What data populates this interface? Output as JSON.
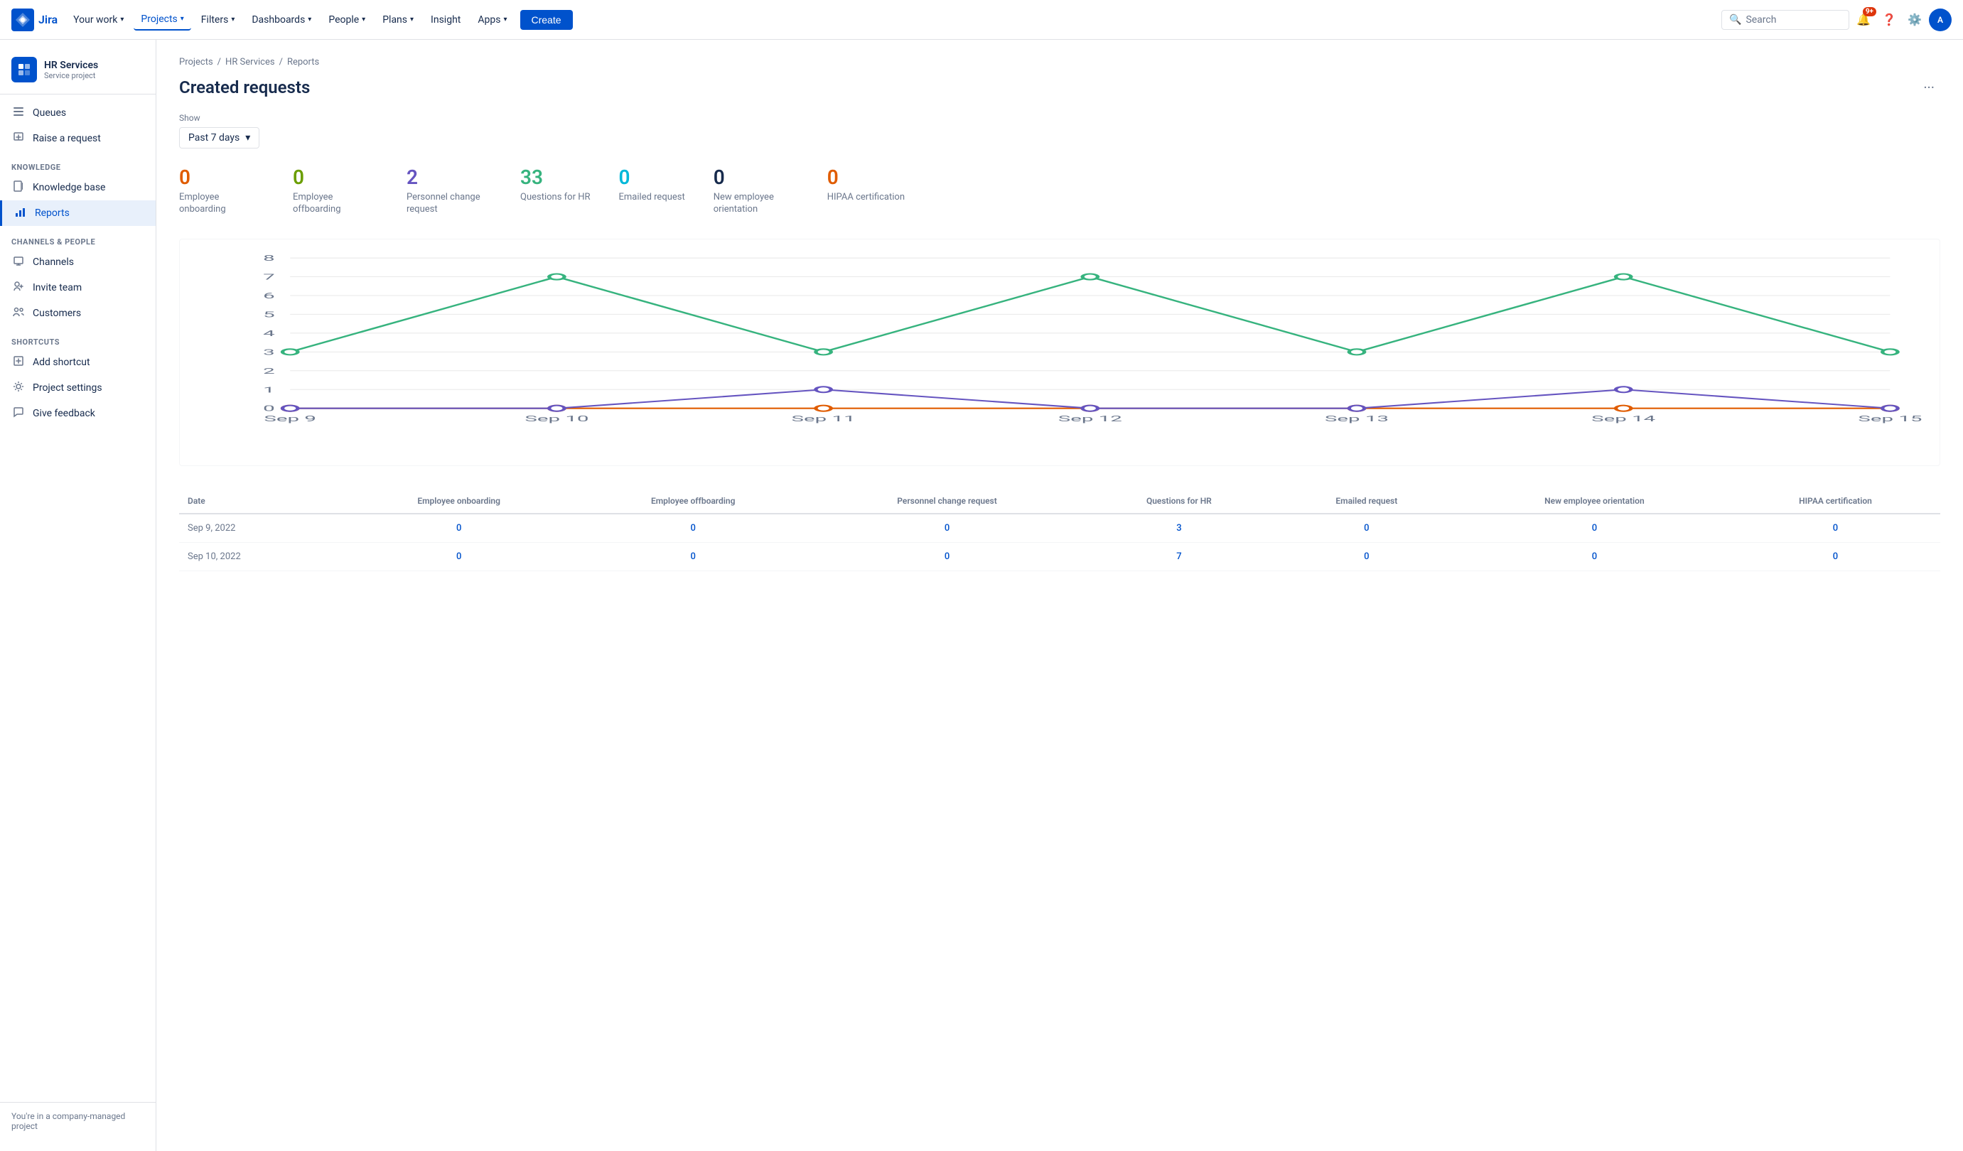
{
  "topnav": {
    "logo_text": "Jira",
    "items": [
      {
        "label": "Your work",
        "has_dropdown": true
      },
      {
        "label": "Projects",
        "has_dropdown": true,
        "active": true
      },
      {
        "label": "Filters",
        "has_dropdown": true
      },
      {
        "label": "Dashboards",
        "has_dropdown": true
      },
      {
        "label": "People",
        "has_dropdown": true
      },
      {
        "label": "Plans",
        "has_dropdown": true
      },
      {
        "label": "Insight",
        "has_dropdown": false
      },
      {
        "label": "Apps",
        "has_dropdown": true
      }
    ],
    "create_label": "Create",
    "search_placeholder": "Search",
    "notification_count": "9+"
  },
  "sidebar": {
    "project_name": "HR Services",
    "project_type": "Service project",
    "nav_items": [
      {
        "label": "Queues",
        "icon": "☰",
        "section": "main"
      },
      {
        "label": "Raise a request",
        "icon": "⬆",
        "section": "main"
      },
      {
        "label": "Knowledge base",
        "icon": "📚",
        "section": "knowledge",
        "section_header": "KNOWLEDGE"
      },
      {
        "label": "Reports",
        "icon": "📊",
        "section": "knowledge",
        "active": true
      },
      {
        "label": "Channels",
        "icon": "🖥",
        "section": "channels",
        "section_header": "CHANNELS & PEOPLE"
      },
      {
        "label": "Invite team",
        "icon": "👤",
        "section": "channels"
      },
      {
        "label": "Customers",
        "icon": "👥",
        "section": "channels"
      },
      {
        "label": "Add shortcut",
        "icon": "➕",
        "section": "shortcuts",
        "section_header": "SHORTCUTS"
      },
      {
        "label": "Project settings",
        "icon": "⚙",
        "section": "shortcuts2"
      },
      {
        "label": "Give feedback",
        "icon": "💬",
        "section": "shortcuts2"
      }
    ],
    "footer_text": "You're in a company-managed project"
  },
  "breadcrumb": {
    "items": [
      "Projects",
      "HR Services",
      "Reports"
    ]
  },
  "page": {
    "title": "Created requests",
    "show_label": "Show",
    "show_value": "Past 7 days"
  },
  "metrics": [
    {
      "value": "0",
      "label": "Employee onboarding",
      "color": "#e05c00"
    },
    {
      "value": "0",
      "label": "Employee offboarding",
      "color": "#6b9e00"
    },
    {
      "value": "2",
      "label": "Personnel change request",
      "color": "#6554c0"
    },
    {
      "value": "33",
      "label": "Questions for HR",
      "color": "#36b37e"
    },
    {
      "value": "0",
      "label": "Emailed request",
      "color": "#00b8d9"
    },
    {
      "value": "0",
      "label": "New employee orientation",
      "color": "#172b4d"
    },
    {
      "value": "0",
      "label": "HIPAA certification",
      "color": "#e05c00"
    }
  ],
  "chart": {
    "x_labels": [
      "Sep 9",
      "Sep 10",
      "Sep 11",
      "Sep 12",
      "Sep 13",
      "Sep 14",
      "Sep 15"
    ],
    "y_labels": [
      "0",
      "1",
      "2",
      "3",
      "4",
      "5",
      "6",
      "7",
      "8"
    ],
    "green_line": [
      3,
      7,
      3,
      7,
      3,
      7,
      3
    ],
    "purple_line": [
      0,
      0,
      1,
      0,
      0,
      1,
      0
    ],
    "red_line": [
      0,
      0,
      0,
      0,
      0,
      0,
      0
    ],
    "green_color": "#36b37e",
    "purple_color": "#6554c0",
    "red_color": "#e05c00"
  },
  "table": {
    "headers": [
      "Date",
      "Employee onboarding",
      "Employee offboarding",
      "Personnel change request",
      "Questions for HR",
      "Emailed request",
      "New employee orientation",
      "HIPAA certification"
    ],
    "rows": [
      {
        "date": "Sep 9, 2022",
        "values": [
          "0",
          "0",
          "0",
          "3",
          "0",
          "0",
          "0"
        ]
      },
      {
        "date": "Sep 10, 2022",
        "values": [
          "0",
          "0",
          "0",
          "7",
          "0",
          "0",
          "0"
        ]
      }
    ]
  }
}
